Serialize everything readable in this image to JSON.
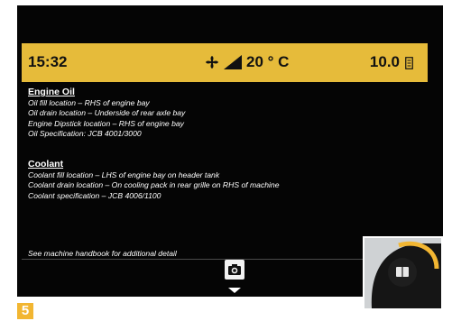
{
  "status_bar": {
    "time": "15:32",
    "temperature": "20 ° C",
    "fuel_value": "10.0",
    "icons": [
      "fan-icon",
      "ramp-icon",
      "fuel-icon"
    ]
  },
  "sections": [
    {
      "title": "Engine Oil",
      "lines": [
        "Oil fill location – RHS of engine bay",
        "Oil drain location – Underside of rear axle bay",
        "Engine Dipstick location – RHS of engine bay",
        "Oil Specification: JCB 4001/3000"
      ]
    },
    {
      "title": "Coolant",
      "lines": [
        "Coolant fill location – LHS of engine bay on header tank",
        "Coolant drain location – On cooling pack in rear grille on RHS of machine",
        "Coolant specification – JCB 4006/1100"
      ]
    }
  ],
  "footer_note": "See machine handbook for additional detail",
  "badge": "5",
  "colors": {
    "status_bar": "#e6bb3a",
    "screen_bg": "#050505",
    "badge": "#f2b632"
  }
}
